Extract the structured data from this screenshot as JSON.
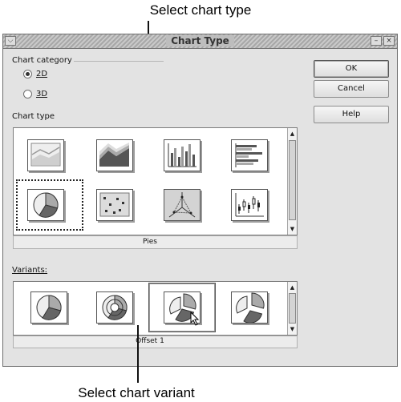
{
  "callouts": {
    "top": "Select chart type",
    "bottom": "Select chart variant"
  },
  "dialog": {
    "title": "Chart Type",
    "title_buttons": [
      "menu-icon",
      "minimize-icon",
      "close-icon"
    ]
  },
  "category": {
    "label": "Chart category",
    "options": [
      {
        "label": "2D",
        "checked": true
      },
      {
        "label": "3D",
        "checked": false
      }
    ]
  },
  "chart_type": {
    "label": "Chart type",
    "icons": [
      "area-chart-icon",
      "stacked-area-3d-chart-icon",
      "vertical-bar-chart-icon",
      "horizontal-bar-chart-icon",
      "pie-chart-icon",
      "xy-scatter-chart-icon",
      "net-chart-icon",
      "stock-chart-icon"
    ],
    "selected": "pie-chart-icon",
    "selected_name": "Pies"
  },
  "variants": {
    "label": "Variants:",
    "icons": [
      "normal-pie-variant-icon",
      "ring-pie-variant-icon",
      "offset-pie-variant-icon",
      "offset-pie-variant-2-icon"
    ],
    "selected": "offset-pie-variant-icon",
    "selected_name": "Offset 1"
  },
  "buttons": {
    "ok": "OK",
    "cancel": "Cancel",
    "help": "Help"
  },
  "colors": {
    "dialog_bg": "#e3e3e3",
    "pie_dark": "#666666",
    "pie_mid": "#a8a8a8",
    "pie_light": "#eeeeee"
  }
}
